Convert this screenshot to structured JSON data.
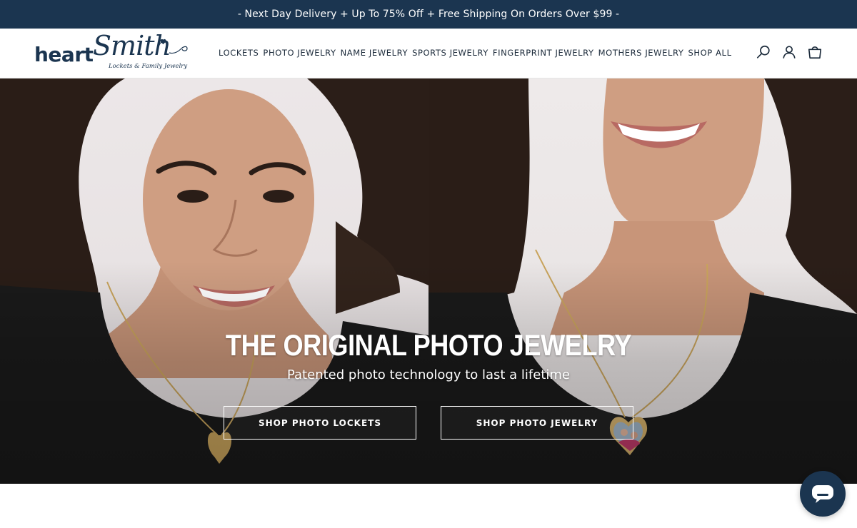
{
  "announcement": {
    "text": "- Next Day Delivery + Up To 75% Off + Free Shipping On Orders Over $99 -"
  },
  "logo": {
    "word": "heart",
    "script": "Smith",
    "tagline": "Lockets & Family Jewelry"
  },
  "nav": {
    "items": [
      "LOCKETS",
      "PHOTO JEWELRY",
      "NAME JEWELRY",
      "SPORTS JEWELRY",
      "FINGERPRINT JEWELRY",
      "MOTHERS JEWELRY",
      "SHOP ALL"
    ]
  },
  "header_icons": [
    "search-icon",
    "account-icon",
    "cart-icon"
  ],
  "hero": {
    "title": "THE ORIGINAL PHOTO JEWELRY",
    "subtitle": "Patented photo technology to last a lifetime",
    "buttons": {
      "lockets": "SHOP PHOTO LOCKETS",
      "jewelry": "SHOP PHOTO JEWELRY"
    }
  },
  "chat": {
    "icon": "chat-bubble-icon"
  },
  "colors": {
    "brand_navy": "#1b3550",
    "text_dark": "#1b2a3a",
    "gold": "#c9a45c",
    "white": "#ffffff"
  }
}
